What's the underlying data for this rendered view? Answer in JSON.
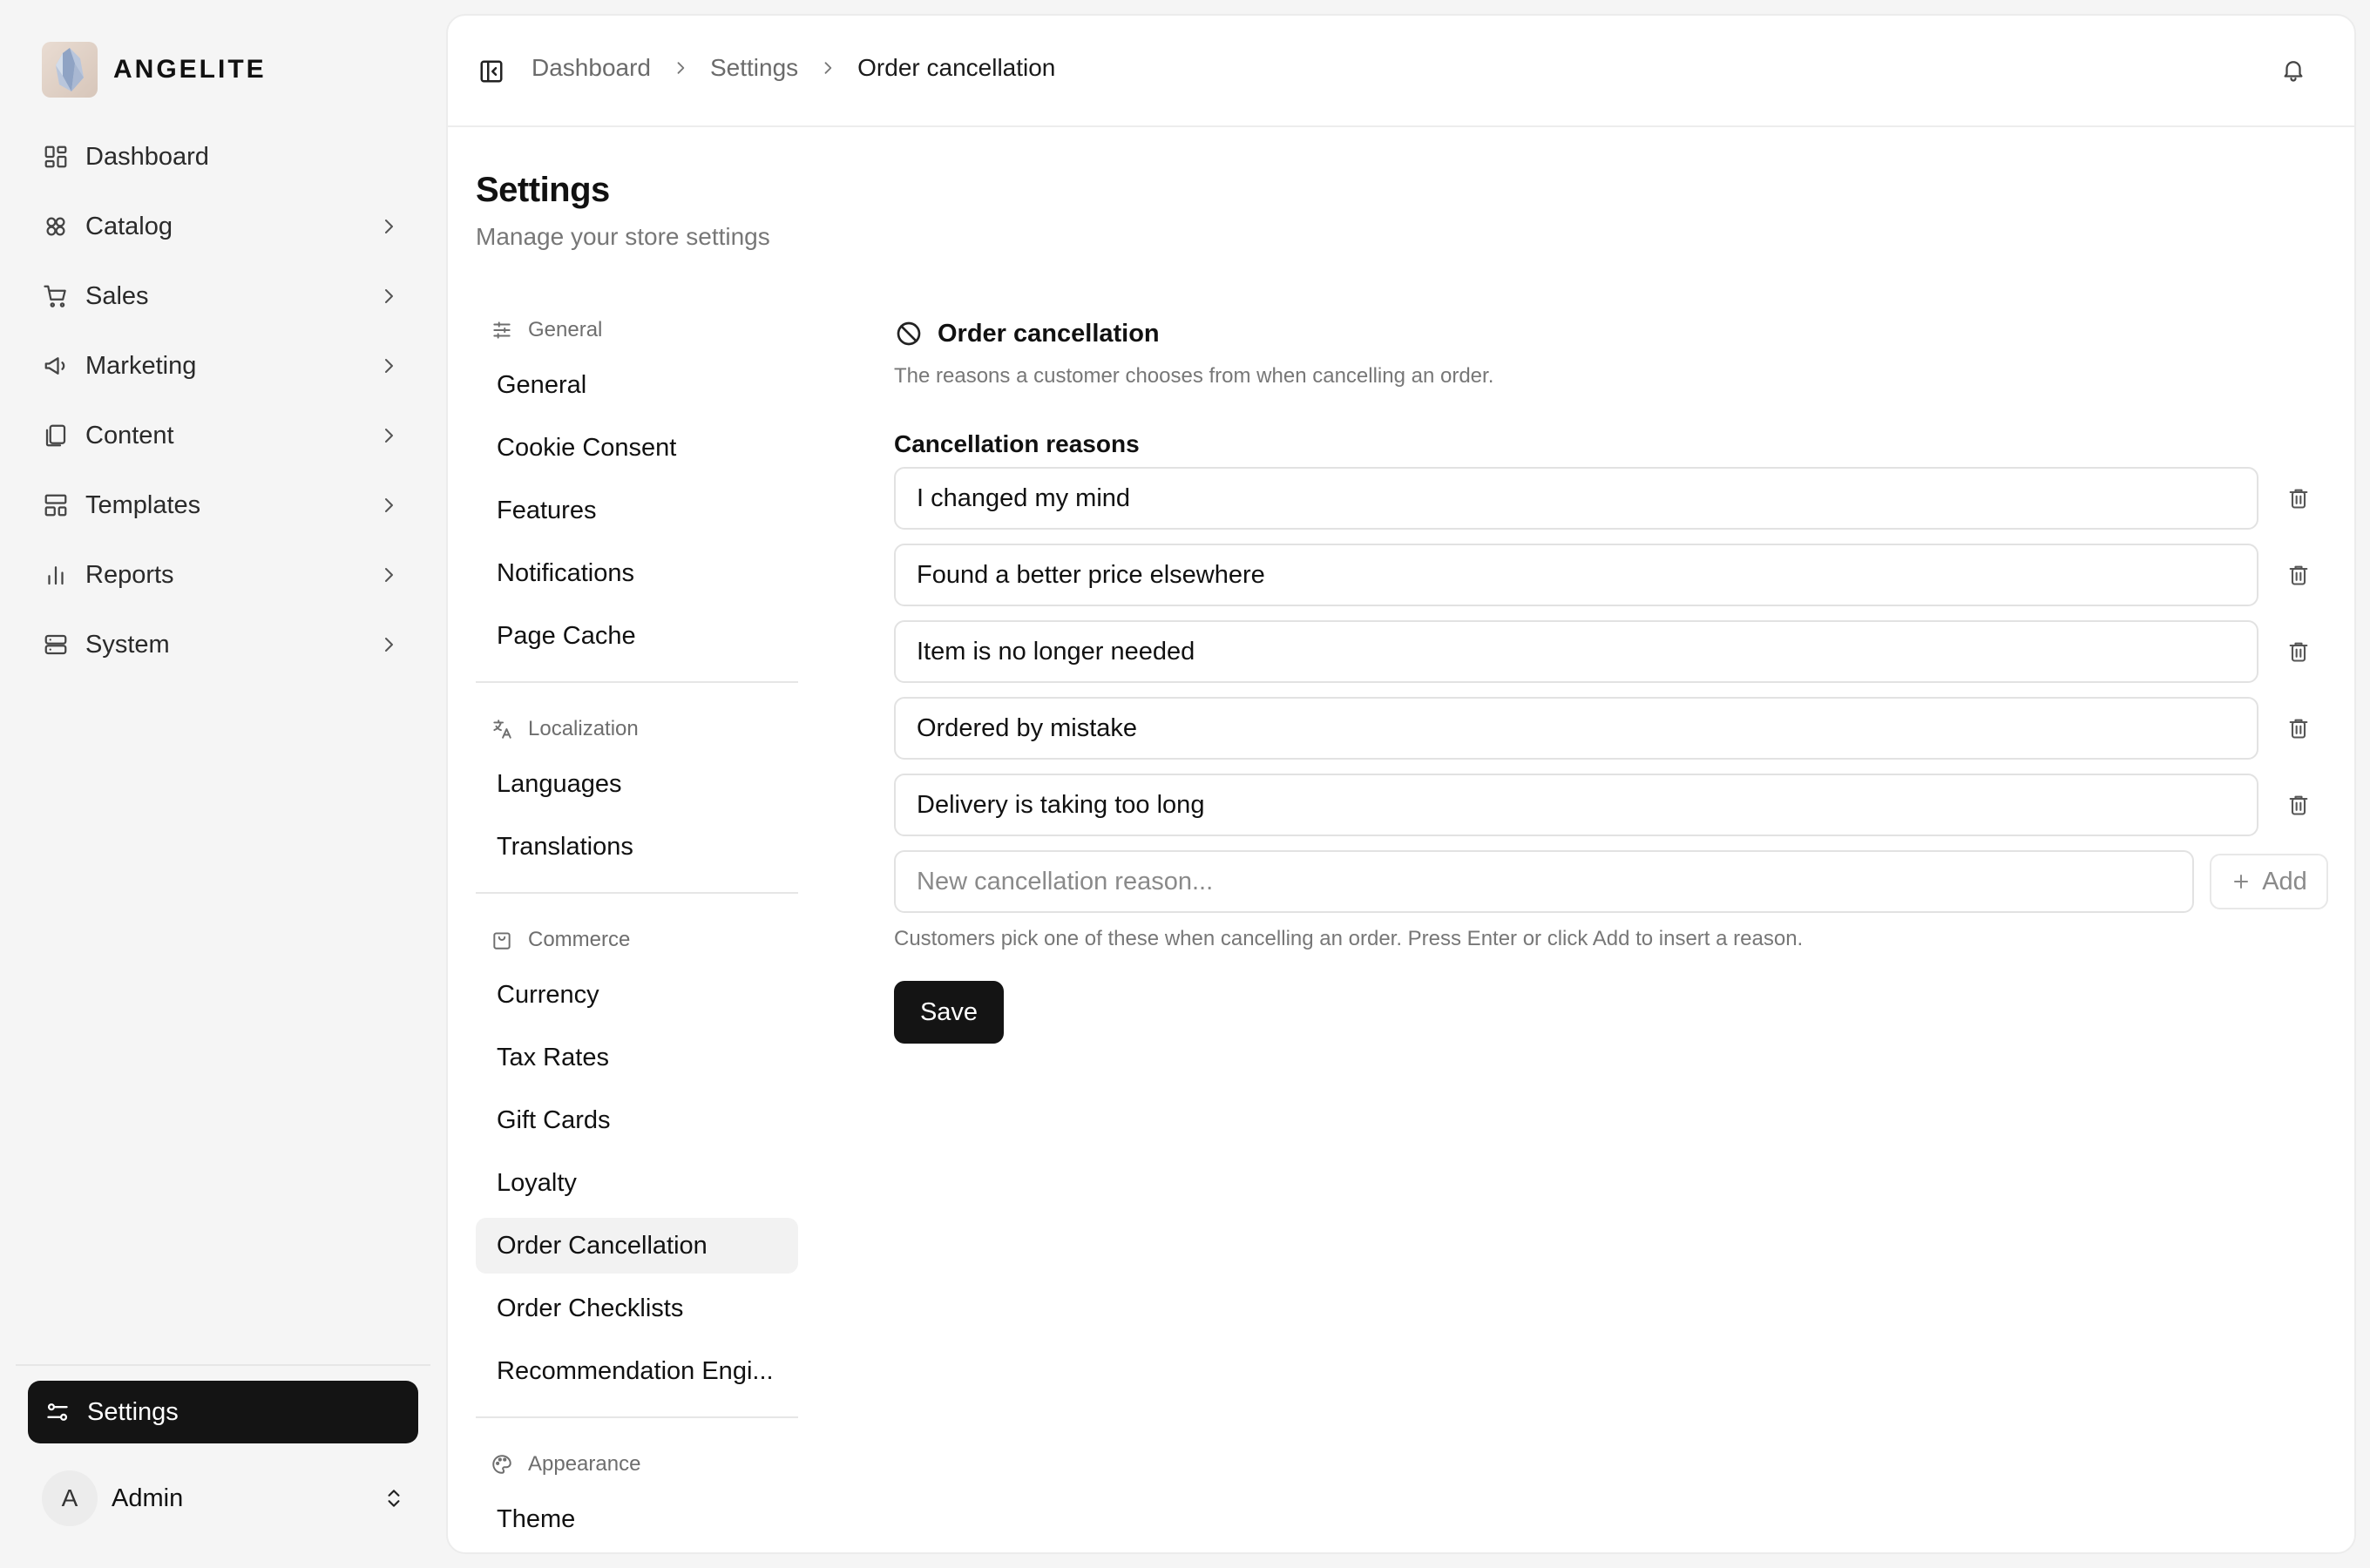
{
  "brand": {
    "name": "ANGELITE",
    "logo_icon": "crystal-logo"
  },
  "sidebar": {
    "items": [
      {
        "label": "Dashboard",
        "icon": "layout-grid-icon",
        "has_chevron": false
      },
      {
        "label": "Catalog",
        "icon": "boxes-icon",
        "has_chevron": true
      },
      {
        "label": "Sales",
        "icon": "cart-icon",
        "has_chevron": true
      },
      {
        "label": "Marketing",
        "icon": "megaphone-icon",
        "has_chevron": true
      },
      {
        "label": "Content",
        "icon": "files-icon",
        "has_chevron": true
      },
      {
        "label": "Templates",
        "icon": "template-icon",
        "has_chevron": true
      },
      {
        "label": "Reports",
        "icon": "bar-chart-icon",
        "has_chevron": true
      },
      {
        "label": "System",
        "icon": "server-icon",
        "has_chevron": true
      }
    ],
    "settings_label": "Settings",
    "user": {
      "initial": "A",
      "name": "Admin"
    }
  },
  "breadcrumb": {
    "items": [
      "Dashboard",
      "Settings"
    ],
    "current": "Order cancellation"
  },
  "page": {
    "title": "Settings",
    "subtitle": "Manage your store settings"
  },
  "settings_nav": {
    "groups": [
      {
        "header": "General",
        "icon": "sliders-icon",
        "items": [
          "General",
          "Cookie Consent",
          "Features",
          "Notifications",
          "Page Cache"
        ]
      },
      {
        "header": "Localization",
        "icon": "translate-icon",
        "items": [
          "Languages",
          "Translations"
        ]
      },
      {
        "header": "Commerce",
        "icon": "shopping-bag-icon",
        "items": [
          "Currency",
          "Tax Rates",
          "Gift Cards",
          "Loyalty",
          "Order Cancellation",
          "Order Checklists",
          "Recommendation Engi..."
        ]
      },
      {
        "header": "Appearance",
        "icon": "palette-icon",
        "items": [
          "Theme"
        ]
      }
    ],
    "active": "Order Cancellation"
  },
  "section": {
    "title": "Order cancellation",
    "description": "The reasons a customer chooses from when cancelling an order.",
    "field_label": "Cancellation reasons",
    "reasons": [
      "I changed my mind",
      "Found a better price elsewhere",
      "Item is no longer needed",
      "Ordered by mistake",
      "Delivery is taking too long"
    ],
    "new_placeholder": "New cancellation reason...",
    "add_label": "Add",
    "hint": "Customers pick one of these when cancelling an order. Press Enter or click Add to insert a reason.",
    "save_label": "Save"
  },
  "colors": {
    "primary": "#141414",
    "muted_text": "#777777",
    "border": "#e2e2e2",
    "active_bg": "#f2f2f2"
  }
}
